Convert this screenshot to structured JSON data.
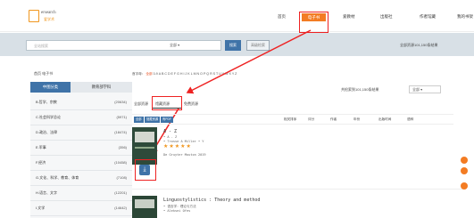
{
  "header": {
    "logo_text": "ersearch",
    "logo_sub": "爱学术",
    "nav": [
      "首页",
      "电子书",
      "爱教材",
      "出版社",
      "作者馆藏",
      "我的书架"
    ],
    "active_index": 1
  },
  "search": {
    "placeholder": "全站搜索",
    "scope": "全部",
    "search_label": "搜索",
    "retrieve_label": "高级检索",
    "result_info": "全部资源101,150条结果"
  },
  "sidebar": {
    "breadcrumb": "首页 电子书",
    "tabs": [
      "中图分类",
      "教育部学科"
    ],
    "categories": [
      {
        "name": "B.哲学、宗教",
        "count": "(20634)"
      },
      {
        "name": "C.社会科学总论",
        "count": "(5971)"
      },
      {
        "name": "D.政治、法律",
        "count": "(18474)"
      },
      {
        "name": "E.军事",
        "count": "(356)"
      },
      {
        "name": "F.经济",
        "count": "(10458)"
      },
      {
        "name": "G.文化、科学、教育、体育",
        "count": "(7108)"
      },
      {
        "name": "H.语言、文字",
        "count": "(12201)"
      },
      {
        "name": "I.文学",
        "count": "(14642)"
      }
    ]
  },
  "main": {
    "alpha_label": "首字母：",
    "alpha_all": "全部",
    "alpha_letters": "0-9 A B C D E F G H I J K L M N O P Q R S T U V W X Y Z",
    "subtabs": [
      "全部资源",
      "馆藏资源",
      "免费资源"
    ],
    "count_text": "共检索到101,150条结果",
    "sort_select": "全部",
    "chips": [
      "全部",
      "馆藏资源",
      "有PDF"
    ],
    "sort_cols": [
      "相关排序",
      "评分",
      "作者",
      "年份",
      "出版时间",
      "语种"
    ],
    "books": [
      {
        "title": "A - Z",
        "meta1": "• A - Z",
        "meta2": "• Trosse A Miller • Y",
        "publisher": "De Gruyter Mouton 2019"
      },
      {
        "title": "Linguostylistics : Theory and method",
        "meta1": "• 语言学：理论与方法",
        "meta2": "• Aleksei Ofes"
      }
    ]
  },
  "colors": {
    "accent": "#f37c23",
    "primary": "#3f73a8",
    "annotation_red": "#e22"
  }
}
